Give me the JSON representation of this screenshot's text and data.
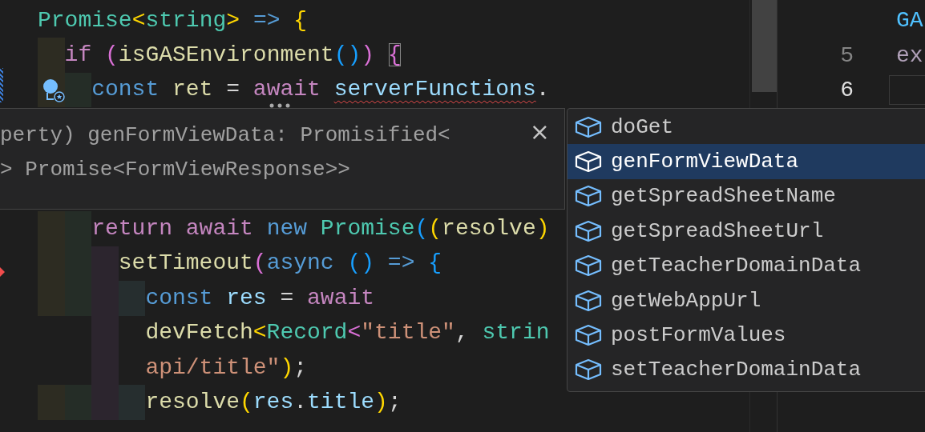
{
  "editor": {
    "lines_top": [
      {
        "tokens": [
          {
            "t": "Promise",
            "kind": "type"
          },
          {
            "t": "<",
            "kind": "b1"
          },
          {
            "t": "string",
            "kind": "type"
          },
          {
            "t": ">",
            "kind": "b1"
          },
          {
            "t": " => ",
            "kind": "kw"
          },
          {
            "t": "{",
            "kind": "b1"
          }
        ]
      },
      {
        "guides": [
          {
            "color": "#2d2c22"
          }
        ],
        "tokens": [
          {
            "t": "if ",
            "kind": "ctrl"
          },
          {
            "t": "(",
            "kind": "b2"
          },
          {
            "t": "isGASEnvironment",
            "kind": "func"
          },
          {
            "t": "()",
            "kind": "b3"
          },
          {
            "t": ") ",
            "kind": "b2"
          },
          {
            "t": "{",
            "kind": "match"
          }
        ]
      },
      {
        "lightbulb": true,
        "guides": [
          {
            "color": "#2d2c22"
          },
          {
            "color": "#252d27"
          }
        ],
        "tokens": [
          {
            "t": "const ",
            "kind": "kw"
          },
          {
            "t": "ret",
            "kind": "name"
          },
          {
            "t": " = ",
            "kind": "punct"
          },
          {
            "t": "await ",
            "kind": "ctrl"
          },
          {
            "t": "serverFunctions",
            "kind": "error"
          },
          {
            "t": ".",
            "kind": "punct"
          }
        ]
      }
    ],
    "lines_bottom": [
      {
        "guides": [
          {
            "color": "#2d2c22"
          },
          {
            "color": "#252d27"
          }
        ],
        "tokens": [
          {
            "t": "return ",
            "kind": "ctrl"
          },
          {
            "t": "await ",
            "kind": "ctrl"
          },
          {
            "t": "new ",
            "kind": "kw"
          },
          {
            "t": "Promise",
            "kind": "type"
          },
          {
            "t": "(",
            "kind": "b3"
          },
          {
            "t": "(",
            "kind": "b1"
          },
          {
            "t": "resolve",
            "kind": "name"
          },
          {
            "t": ")",
            "kind": "b1"
          }
        ]
      },
      {
        "guides": [
          {
            "color": "#2d2c22"
          },
          {
            "color": "#252d27"
          },
          {
            "color": "#2c252e"
          }
        ],
        "tokens": [
          {
            "t": "setTimeout",
            "kind": "func"
          },
          {
            "t": "(",
            "kind": "b2"
          },
          {
            "t": "async ",
            "kind": "kw"
          },
          {
            "t": "()",
            "kind": "b3"
          },
          {
            "t": " => ",
            "kind": "kw"
          },
          {
            "t": "{",
            "kind": "b3"
          }
        ]
      },
      {
        "guides": [
          {
            "color": "#2d2c22"
          },
          {
            "color": "#252d27"
          },
          {
            "color": "#2c252e"
          },
          {
            "color": "#262e2f"
          }
        ],
        "tokens": [
          {
            "t": "const ",
            "kind": "kw"
          },
          {
            "t": "res",
            "kind": "var"
          },
          {
            "t": " = ",
            "kind": "punct"
          },
          {
            "t": "await",
            "kind": "ctrl"
          }
        ]
      },
      {
        "guides": [
          {
            "kind": "blank"
          },
          {
            "kind": "blank"
          },
          {
            "kind": "band",
            "color": "#2c252e"
          },
          {
            "kind": "blank"
          }
        ],
        "tokens": [
          {
            "t": "devFetch",
            "kind": "func"
          },
          {
            "t": "<",
            "kind": "b1"
          },
          {
            "t": "Record",
            "kind": "type"
          },
          {
            "t": "<",
            "kind": "b2"
          },
          {
            "t": "\"title\"",
            "kind": "string"
          },
          {
            "t": ", ",
            "kind": "punct"
          },
          {
            "t": "strin",
            "kind": "type"
          }
        ]
      },
      {
        "guides": [
          {
            "kind": "blank"
          },
          {
            "kind": "blank"
          },
          {
            "kind": "band",
            "color": "#2c252e"
          },
          {
            "kind": "blank"
          }
        ],
        "tokens": [
          {
            "t": "api/title\"",
            "kind": "string"
          },
          {
            "t": ")",
            "kind": "b1"
          },
          {
            "t": ";",
            "kind": "punct"
          }
        ]
      },
      {
        "guides": [
          {
            "color": "#2d2c22"
          },
          {
            "color": "#252d27"
          },
          {
            "color": "#2c252e"
          },
          {
            "color": "#262e2f"
          }
        ],
        "tokens": [
          {
            "t": "resolve",
            "kind": "func"
          },
          {
            "t": "(",
            "kind": "b1"
          },
          {
            "t": "res",
            "kind": "var"
          },
          {
            "t": ".",
            "kind": "punct"
          },
          {
            "t": "title",
            "kind": "var"
          },
          {
            "t": ")",
            "kind": "b1"
          },
          {
            "t": ";",
            "kind": "punct"
          }
        ]
      }
    ]
  },
  "hover": {
    "lines": [
      "perty) genFormViewData: Promisified<",
      "> Promise<FormViewResponse>>"
    ],
    "close": "×"
  },
  "suggestions": [
    {
      "label": "doGet",
      "selected": false
    },
    {
      "label": "genFormViewData",
      "selected": true
    },
    {
      "label": "getSpreadSheetName",
      "selected": false
    },
    {
      "label": "getSpreadSheetUrl",
      "selected": false
    },
    {
      "label": "getTeacherDomainData",
      "selected": false
    },
    {
      "label": "getWebAppUrl",
      "selected": false
    },
    {
      "label": "postFormValues",
      "selected": false
    },
    {
      "label": "setTeacherDomainData",
      "selected": false
    }
  ],
  "side_editor": {
    "lines": [
      {
        "text": "GA",
        "current": false
      },
      {
        "number": "5",
        "text": "ex",
        "current": false
      },
      {
        "number": "6",
        "current": true
      }
    ]
  }
}
